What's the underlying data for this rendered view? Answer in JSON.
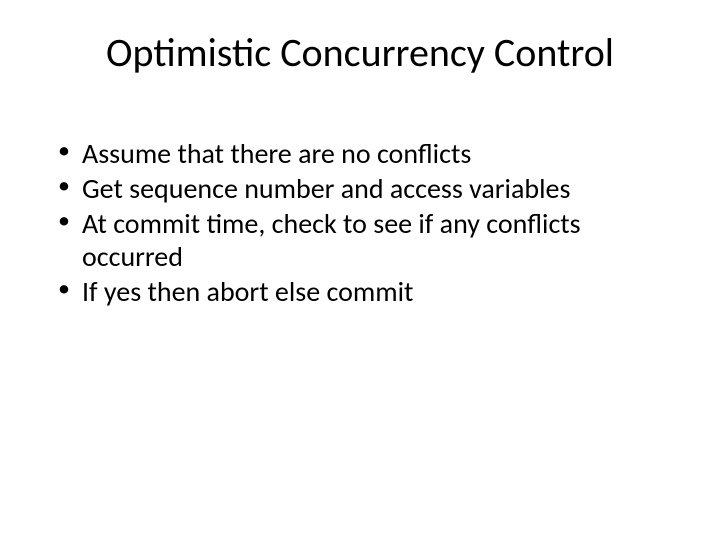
{
  "title": "Optimistic Concurrency Control",
  "bullets": [
    "Assume that there are no conflicts",
    "Get sequence number and access variables",
    "At commit time, check to see if any conflicts occurred",
    "If yes then abort else commit"
  ]
}
